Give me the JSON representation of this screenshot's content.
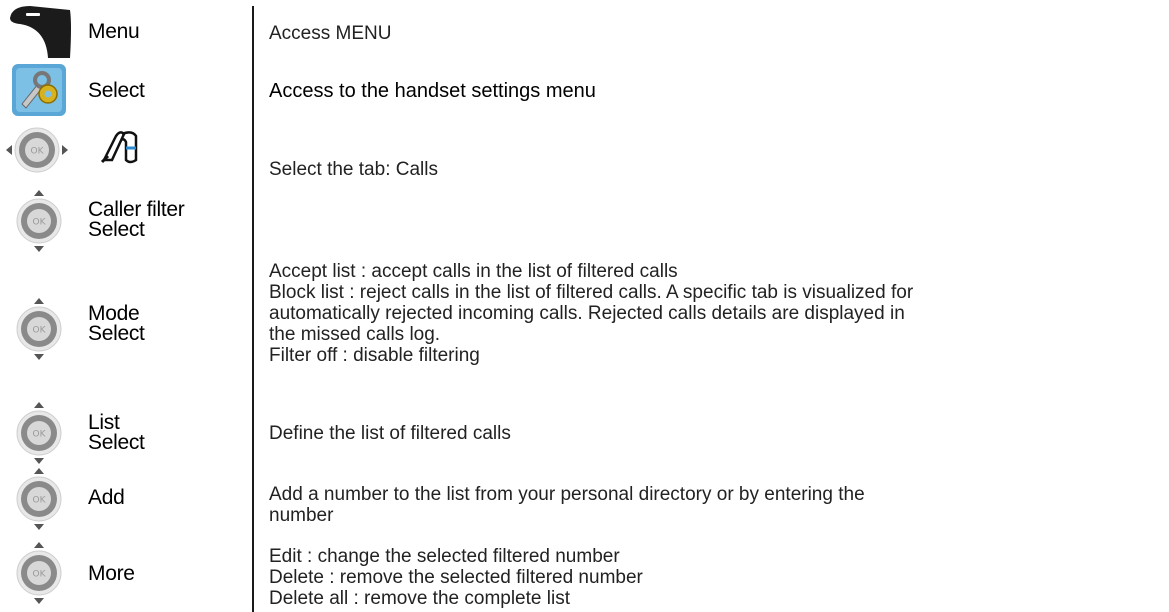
{
  "rows": [
    {
      "icon": "soft-key-icon",
      "labels": [
        "Menu"
      ],
      "desc": [
        "Access MENU"
      ]
    },
    {
      "icon": "settings-wrench-gear-icon",
      "labels": [
        "Select"
      ],
      "desc": [
        "Access to the handset settings menu"
      ]
    },
    {
      "icon": "navigation-key-left-right-icon",
      "secondary_icon": "calls-tab-icon",
      "labels": [],
      "desc": [
        "Select the tab: Calls"
      ]
    },
    {
      "icon": "navigation-key-up-down-icon",
      "labels": [
        "Caller filter",
        "Select"
      ],
      "desc": []
    },
    {
      "icon": "navigation-key-up-down-icon",
      "labels": [
        "Mode",
        "Select"
      ],
      "desc": [
        "Accept list : accept calls in the list of filtered calls",
        "Block list : reject calls in the list of filtered calls. A specific tab is visualized for",
        "automatically rejected incoming calls. Rejected calls details are displayed in",
        "the missed calls log.",
        "Filter off : disable filtering"
      ]
    },
    {
      "icon": "navigation-key-up-down-icon",
      "labels": [
        "List",
        "Select"
      ],
      "desc": [
        "Define the list of filtered calls"
      ]
    },
    {
      "icon": "navigation-key-up-down-icon",
      "labels": [
        "Add"
      ],
      "desc": [
        "Add a number to the list from your personal directory or by entering the",
        "number"
      ]
    },
    {
      "icon": "navigation-key-up-down-icon",
      "labels": [
        "More"
      ],
      "desc": [
        "Edit : change the selected filtered number",
        "Delete : remove the selected filtered number",
        "Delete all : remove the complete list"
      ]
    }
  ],
  "colors": {
    "key_ring": "#8a8a8a",
    "key_center": "#d8d8d8",
    "ok_text": "#9a9a9a",
    "settings_bg": "#5aa6d6",
    "gear": "#d8b21e"
  }
}
